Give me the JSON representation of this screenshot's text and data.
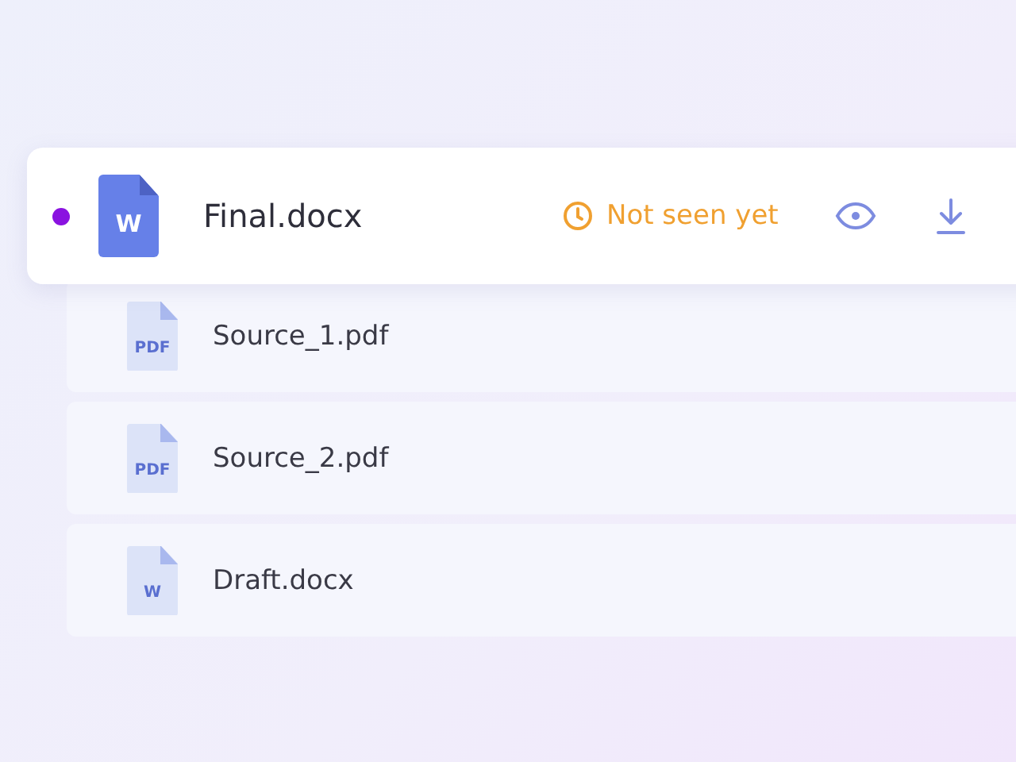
{
  "main_file": {
    "name": "Final.docx",
    "icon_label": "W",
    "unread": true,
    "status": {
      "kind": "pending",
      "text": "Not seen yet"
    }
  },
  "attachments": [
    {
      "name": "Source_1.pdf",
      "icon_label": "PDF"
    },
    {
      "name": "Source_2.pdf",
      "icon_label": "PDF"
    },
    {
      "name": "Draft.docx",
      "icon_label": "W"
    }
  ]
}
